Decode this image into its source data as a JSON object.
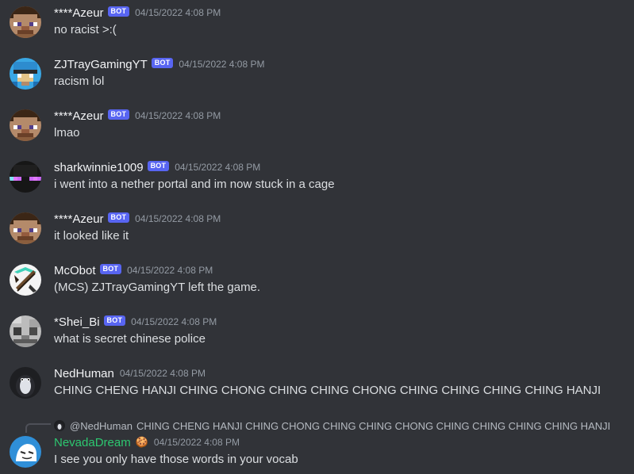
{
  "messages": [
    {
      "username": "****Azeur",
      "bot_tag": "BOT",
      "timestamp": "04/15/2022 4:08 PM",
      "content": "no racist >:("
    },
    {
      "username": "ZJTrayGamingYT",
      "bot_tag": "BOT",
      "timestamp": "04/15/2022 4:08 PM",
      "content": "racism lol"
    },
    {
      "username": "****Azeur",
      "bot_tag": "BOT",
      "timestamp": "04/15/2022 4:08 PM",
      "content": "lmao"
    },
    {
      "username": "sharkwinnie1009",
      "bot_tag": "BOT",
      "timestamp": "04/15/2022 4:08 PM",
      "content": "i went into a nether portal and im now stuck in a cage"
    },
    {
      "username": "****Azeur",
      "bot_tag": "BOT",
      "timestamp": "04/15/2022 4:08 PM",
      "content": "it looked like it"
    },
    {
      "username": "McObot",
      "bot_tag": "BOT",
      "timestamp": "04/15/2022 4:08 PM",
      "content": "(MCS) ZJTrayGamingYT left the game."
    },
    {
      "username": "*Shei_Bi",
      "bot_tag": "BOT",
      "timestamp": "04/15/2022 4:08 PM",
      "content": "what is secret chinese police"
    },
    {
      "username": "NedHuman",
      "timestamp": "04/15/2022 4:08 PM",
      "content": "CHING CHENG HANJI CHING CHONG CHING CHING CHONG CHING CHING CHING CHING HANJI"
    },
    {
      "username": "NevadaDream",
      "name_color": "#2dc770",
      "role_icon": "🍪",
      "timestamp": "04/15/2022 4:08 PM",
      "content": "I see you only have those words in your vocab",
      "reply": {
        "mention": "@NedHuman",
        "text": "CHING CHENG HANJI CHING CHONG CHING CHING CHONG CHING CHING CHING CHING HANJI"
      }
    }
  ],
  "colors": {
    "background": "#313338",
    "username": "#f2f3f5",
    "text": "#dbdee1",
    "timestamp": "#949ba4",
    "bot_tag": "#5865f2"
  },
  "icons": [
    "steve-avatar-icon",
    "diamond-helmet-avatar-icon",
    "enderman-avatar-icon",
    "pickaxe-avatar-icon",
    "skeleton-avatar-icon",
    "penguin-avatar-icon",
    "ghost-avatar-icon"
  ]
}
